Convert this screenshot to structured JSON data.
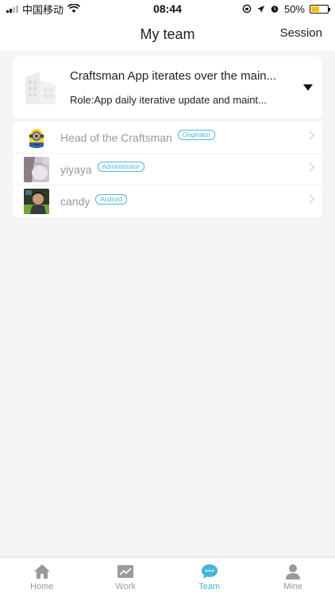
{
  "status_bar": {
    "carrier": "中国移动",
    "time": "08:44",
    "battery": "50%",
    "battery_level": 0.5
  },
  "header": {
    "title": "My team",
    "action_label": "Session"
  },
  "project": {
    "name": "Craftsman App iterates over the main...",
    "role": "Role:App daily iterative update and maint..."
  },
  "members": [
    {
      "name": "Head of the Craftsman",
      "role": "Originator"
    },
    {
      "name": "yiyaya",
      "role": "Administrator"
    },
    {
      "name": "candy",
      "role": "Android"
    }
  ],
  "tabs": [
    {
      "label": "Home",
      "icon": "home-icon"
    },
    {
      "label": "Work",
      "icon": "chart-icon"
    },
    {
      "label": "Team",
      "icon": "chat-bubble-icon",
      "active": true
    },
    {
      "label": "Mine",
      "icon": "person-icon"
    }
  ],
  "colors": {
    "accent": "#44b5d8",
    "background": "#f4f4f4",
    "battery": "#f2c200"
  }
}
